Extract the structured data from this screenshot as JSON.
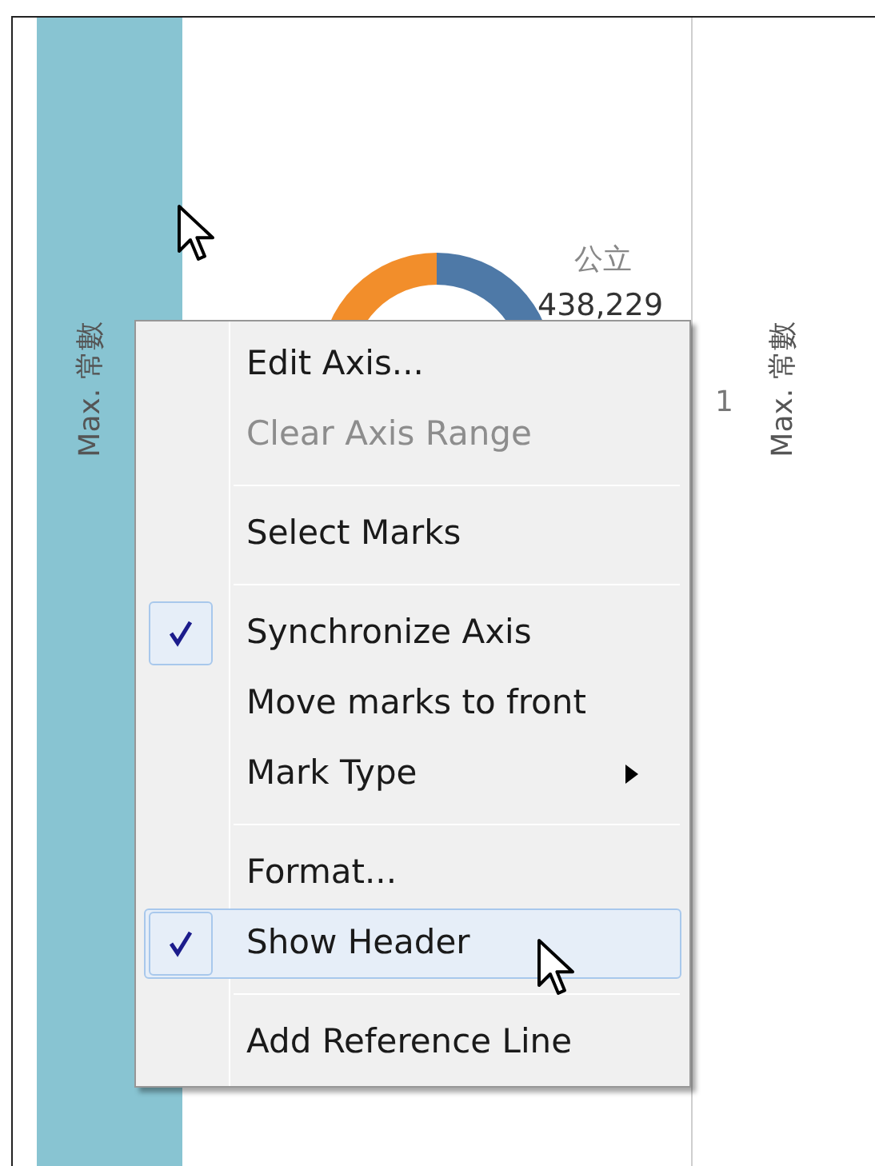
{
  "left_axis_header": {
    "label": "Max. 常數"
  },
  "donut_label": {
    "category": "公立",
    "value": "438,229"
  },
  "axis_value": "1",
  "right_axis_header": {
    "label": "Max. 常數"
  },
  "context_menu": {
    "items": [
      {
        "kind": "item",
        "label": "Edit Axis...",
        "disabled": false,
        "checked": false,
        "submenu": false,
        "highlighted": false
      },
      {
        "kind": "item",
        "label": "Clear Axis Range",
        "disabled": true,
        "checked": false,
        "submenu": false,
        "highlighted": false
      },
      {
        "kind": "separator"
      },
      {
        "kind": "item",
        "label": "Select Marks",
        "disabled": false,
        "checked": false,
        "submenu": false,
        "highlighted": false
      },
      {
        "kind": "separator"
      },
      {
        "kind": "item",
        "label": "Synchronize Axis",
        "disabled": false,
        "checked": true,
        "submenu": false,
        "highlighted": false
      },
      {
        "kind": "item",
        "label": "Move marks to front",
        "disabled": false,
        "checked": false,
        "submenu": false,
        "highlighted": false
      },
      {
        "kind": "item",
        "label": "Mark Type",
        "disabled": false,
        "checked": false,
        "submenu": true,
        "highlighted": false
      },
      {
        "kind": "separator"
      },
      {
        "kind": "item",
        "label": "Format...",
        "disabled": false,
        "checked": false,
        "submenu": false,
        "highlighted": false
      },
      {
        "kind": "item",
        "label": "Show Header",
        "disabled": false,
        "checked": true,
        "submenu": false,
        "highlighted": true
      },
      {
        "kind": "separator"
      },
      {
        "kind": "item",
        "label": "Add Reference Line",
        "disabled": false,
        "checked": false,
        "submenu": false,
        "highlighted": false
      }
    ]
  }
}
